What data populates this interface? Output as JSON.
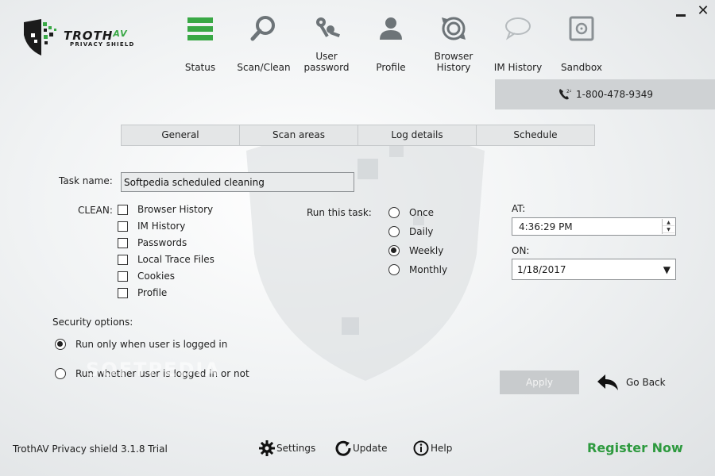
{
  "app": {
    "brand": "TROTH",
    "brand_suffix": "AV",
    "brand_sub": "PRIVACY SHIELD"
  },
  "window": {
    "close_glyph": "✕"
  },
  "nav": [
    {
      "label": "Status",
      "icon": "status-bars-icon"
    },
    {
      "label": "Scan/Clean",
      "icon": "magnifier-icon"
    },
    {
      "label": "User\npassword",
      "icon": "keys-icon"
    },
    {
      "label": "Profile",
      "icon": "person-icon"
    },
    {
      "label": "Browser\nHistory",
      "icon": "history-icon"
    },
    {
      "label": "IM History",
      "icon": "chat-bubble-icon"
    },
    {
      "label": "Sandbox",
      "icon": "safe-icon"
    }
  ],
  "phone": "1-800-478-9349",
  "tabs": [
    "General",
    "Scan areas",
    "Log details",
    "Schedule"
  ],
  "task": {
    "label": "Task name:",
    "value": "Softpedia scheduled cleaning"
  },
  "clean": {
    "label": "CLEAN:",
    "items": [
      "Browser History",
      "IM History",
      "Passwords",
      "Local Trace Files",
      "Cookies",
      "Profile"
    ]
  },
  "run": {
    "label": "Run this task:",
    "options": [
      "Once",
      "Daily",
      "Weekly",
      "Monthly"
    ],
    "selected": "Weekly"
  },
  "at": {
    "label": "AT:",
    "time": "4:36:29 PM"
  },
  "on": {
    "label": "ON:",
    "date": "1/18/2017"
  },
  "security": {
    "label": "Security options:",
    "options": [
      "Run only when user is logged in",
      "Run whether user is logged in or not"
    ],
    "selected": "Run only when user is logged in"
  },
  "buttons": {
    "apply": "Apply",
    "go_back": "Go Back"
  },
  "watermark": "SOFTPEDIA",
  "footer": {
    "version": "TrothAV Privacy shield 3.1.8 Trial",
    "settings": "Settings",
    "update": "Update",
    "help": "Help",
    "register": "Register Now"
  },
  "colors": {
    "accent_green": "#39a845",
    "register_green": "#2e9a3f",
    "icon_gray": "#6d7478"
  }
}
